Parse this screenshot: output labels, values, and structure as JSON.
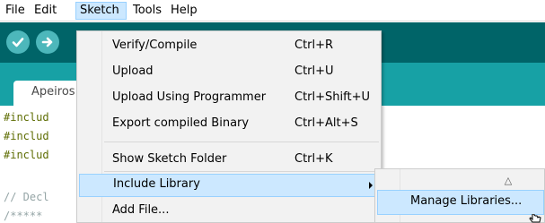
{
  "menubar": {
    "items": [
      {
        "label": "File"
      },
      {
        "label": "Edit"
      },
      {
        "label": "Sketch",
        "active": true
      },
      {
        "label": "Tools"
      },
      {
        "label": "Help"
      }
    ]
  },
  "toolbar": {
    "buttons": [
      {
        "icon": "checkmark-icon",
        "name": "verify-button"
      },
      {
        "icon": "arrow-right-icon",
        "name": "upload-button"
      }
    ],
    "colors": {
      "toolbar": "#006468",
      "tabstrip": "#17a1a5",
      "button": "#4db7bb"
    }
  },
  "tab": {
    "label": "Apeiros"
  },
  "editor": {
    "lines": [
      "#includ",
      "#includ",
      "#includ",
      "",
      "// Decl",
      "/*****"
    ]
  },
  "sketch_menu": {
    "items": [
      {
        "label": "Verify/Compile",
        "shortcut": "Ctrl+R"
      },
      {
        "label": "Upload",
        "shortcut": "Ctrl+U"
      },
      {
        "label": "Upload Using Programmer",
        "shortcut": "Ctrl+Shift+U"
      },
      {
        "label": "Export compiled Binary",
        "shortcut": "Ctrl+Alt+S"
      },
      {
        "label": "Show Sketch Folder",
        "shortcut": "Ctrl+K"
      },
      {
        "label": "Include Library",
        "shortcut": "",
        "highlighted": true,
        "submenu": true
      },
      {
        "label": "Add File...",
        "shortcut": ""
      }
    ]
  },
  "include_library_submenu": {
    "scroll_indicator": "△",
    "items": [
      {
        "label": "Manage Libraries...",
        "highlighted": true
      }
    ]
  }
}
